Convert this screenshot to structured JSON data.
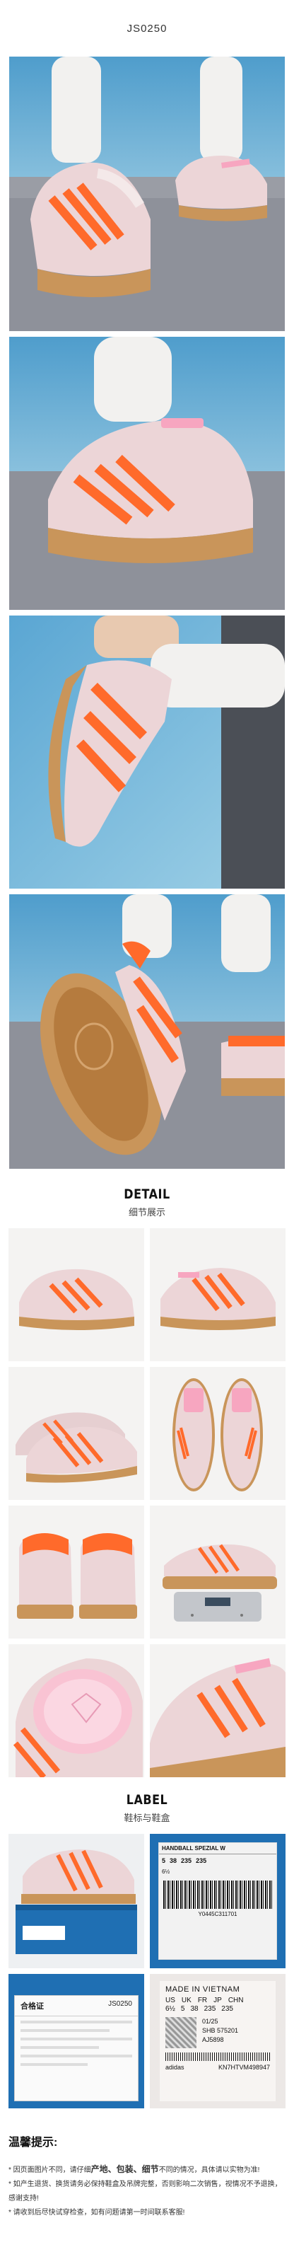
{
  "product_code": "JS0250",
  "detail_section": {
    "title_en": "DETAIL",
    "title_cn": "细节展示"
  },
  "label_section": {
    "title_en": "LABEL",
    "title_cn": "鞋标与鞋盒"
  },
  "box_label": {
    "brand": "adidas",
    "model": "HANDBALL SPEZIAL W",
    "barcode_number": "Y0445C311701",
    "size_headers": [
      "UK",
      "FR",
      "JP",
      "CHN"
    ],
    "size_values": [
      "5",
      "38",
      "235",
      "235"
    ],
    "us_size": "6½",
    "made_in": "MADE IN VIETNAM"
  },
  "tongue_label": {
    "made_in": "MADE IN VIETNAM",
    "size_headers": [
      "US",
      "UK",
      "FR",
      "JP",
      "CHN"
    ],
    "size_values": [
      "6½",
      "5",
      "38",
      "235",
      "235"
    ],
    "date": "01/25",
    "line1": "SHB 575201",
    "line2": "AJ5898",
    "code": "KN7HTVM498947"
  },
  "cert_card": {
    "title": "合格证",
    "code": "JS0250"
  },
  "notice": {
    "title": "温馨提示:",
    "line1_prefix": "* 因页面图片不同，请仔细",
    "highlight1": "产地、包装、细节",
    "line1_suffix": "不同的情况，具体请以实物为准!",
    "line2": "* 如产生退货、换货请务必保持鞋盒及吊牌完整，否则影响二次销售，视情况不予退换，感谢支持!",
    "line3": "* 请收到后尽快试穿检查，如有问题请第一时间联系客服!"
  },
  "colors": {
    "orange": "#ff6a2b",
    "pink_leather": "#ecd5d7",
    "gum": "#c9955a",
    "sky": "#5ea6cf",
    "pavement": "#8a8e98"
  }
}
